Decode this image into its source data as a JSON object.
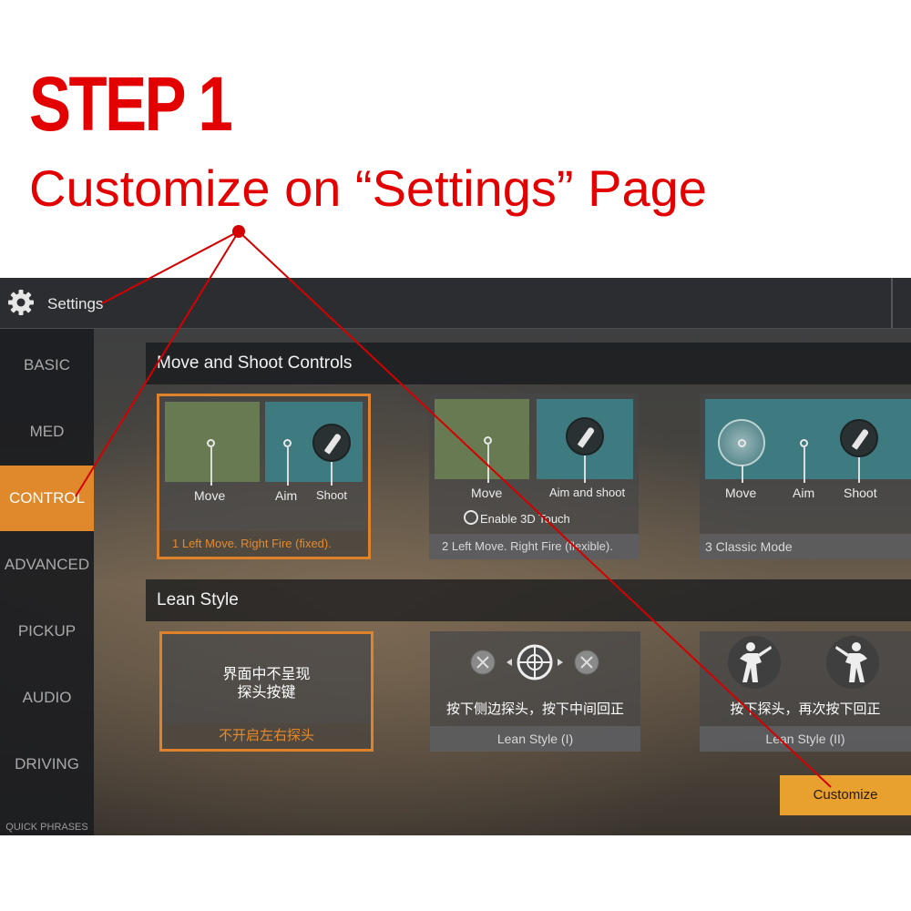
{
  "header": {
    "step": "STEP 1",
    "subtitle": "Customize on “Settings” Page"
  },
  "topbar": {
    "title": "Settings",
    "icon": "gear-icon"
  },
  "sidebar": {
    "items": [
      {
        "label": "BASIC",
        "active": false
      },
      {
        "label": "MED",
        "active": false
      },
      {
        "label": "CONTROL",
        "active": true
      },
      {
        "label": "ADVANCED",
        "active": false
      },
      {
        "label": "PICKUP",
        "active": false
      },
      {
        "label": "AUDIO",
        "active": false
      },
      {
        "label": "DRIVING",
        "active": false
      }
    ],
    "quick_phrases": "QUICK PHRASES"
  },
  "move_shoot": {
    "title": "Move and Shoot Controls",
    "options": [
      {
        "labels": [
          "Move",
          "Aim",
          "Shoot"
        ],
        "caption": "1  Left Move. Right Fire (fixed).",
        "selected": true
      },
      {
        "labels": [
          "Move",
          "Aim and shoot"
        ],
        "toggle": "Enable 3D Touch",
        "caption": "2 Left Move. Right Fire (flexible).",
        "selected": false
      },
      {
        "labels": [
          "Move",
          "Aim",
          "Shoot"
        ],
        "caption": "3 Classic Mode",
        "selected": false
      }
    ]
  },
  "lean_style": {
    "title": "Lean Style",
    "options": [
      {
        "text_line1": "界面中不呈现",
        "text_line2": "探头按键",
        "caption": "不开启左右探头",
        "selected": true
      },
      {
        "text": "按下侧边探头，按下中间回正",
        "caption": "Lean Style (I)",
        "selected": false
      },
      {
        "text": "按下探头，再次按下回正",
        "caption": "Lean Style (II)",
        "selected": false
      }
    ]
  },
  "customize_button": "Customize",
  "colors": {
    "annotation_red": "#e20000",
    "accent_orange": "#e0882c",
    "button_yellow": "#e8a02f"
  }
}
